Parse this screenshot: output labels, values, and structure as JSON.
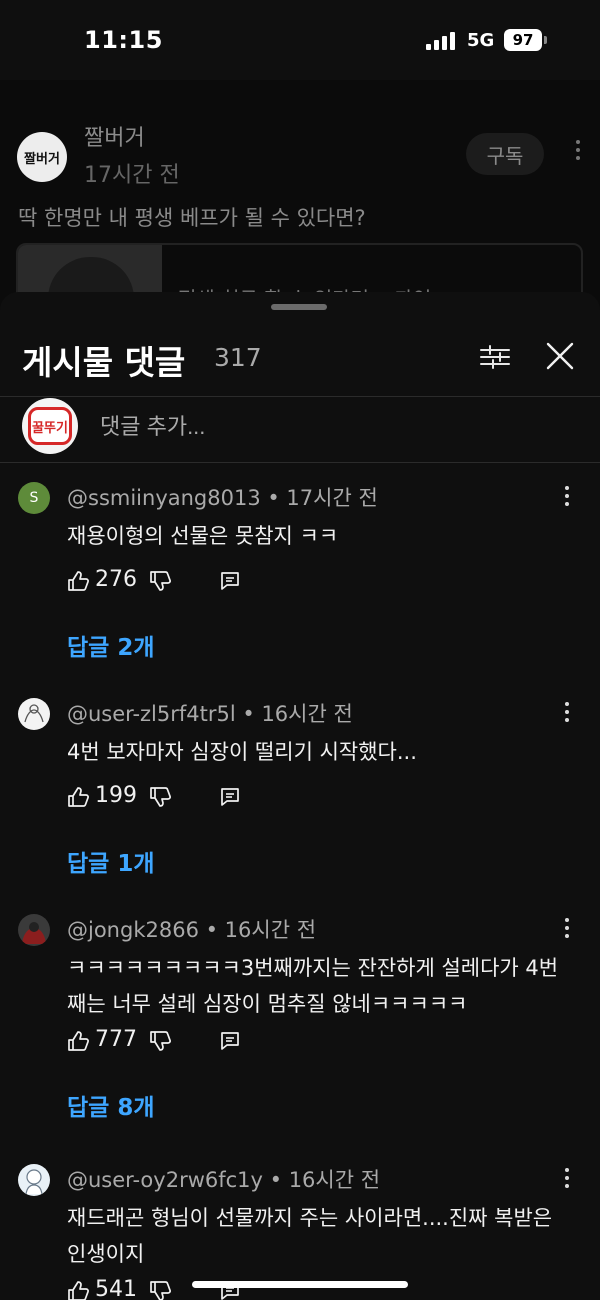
{
  "status_bar": {
    "time": "11:15",
    "network": "5G",
    "battery": "97"
  },
  "post": {
    "channel_name": "짤버거",
    "channel_avatar_text": "짤버거",
    "time_ago": "17시간 전",
    "subscribe_label": "구독",
    "text": "딱 한명만 내 평생 베프가 될 수 있다면?",
    "card_text": "평생 친구 할 수 있다면... 과연"
  },
  "sheet": {
    "title": "게시물 댓글",
    "count": "317",
    "my_avatar_text": "꿀뚜기",
    "add_comment_placeholder": "댓글 추가..."
  },
  "comments": [
    {
      "meta": "@ssmiinyang8013 • 17시간 전",
      "avatar_letter": "S",
      "text": "재용이형의 선물은 못참지 ㅋㅋ",
      "likes": "276",
      "replies": "답글 2개"
    },
    {
      "meta": "@user-zl5rf4tr5l • 16시간 전",
      "text": "4번 보자마자 심장이 떨리기 시작했다...",
      "likes": "199",
      "replies": "답글 1개"
    },
    {
      "meta": "@jongk2866 • 16시간 전",
      "text": "ㅋㅋㅋㅋㅋㅋㅋㅋㅋ3번째까지는 잔잔하게 설레다가 4번째는 너무 설레 심장이 멈추질 않네ㅋㅋㅋㅋㅋ",
      "likes": "777",
      "replies": "답글 8개"
    },
    {
      "meta": "@user-oy2rw6fc1y • 16시간 전",
      "text": "재드래곤 형님이 선물까지 주는 사이라면....진짜 복받은 인생이지",
      "likes": "541"
    }
  ],
  "colors": {
    "accent": "#3ea6ff",
    "background": "#0f0f0f",
    "text_secondary": "#aaaaaa"
  },
  "icons": [
    "signal-icon",
    "battery-icon",
    "filter-icon",
    "close-icon",
    "more-vertical-icon",
    "like-icon",
    "dislike-icon",
    "reply-icon"
  ]
}
